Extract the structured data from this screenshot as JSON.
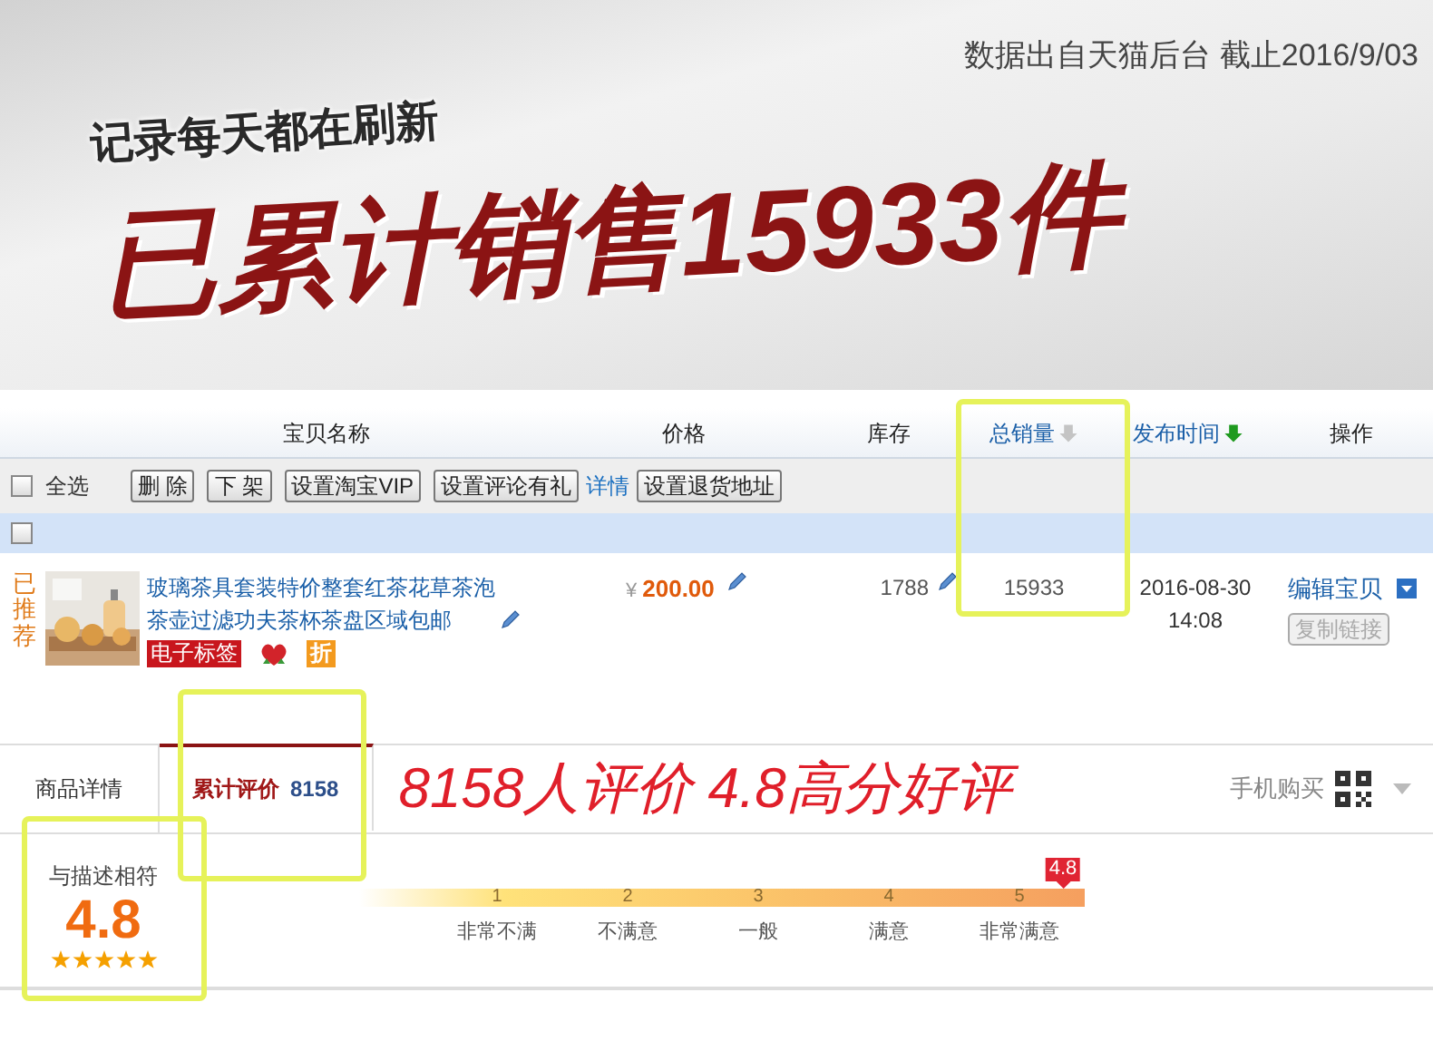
{
  "banner": {
    "source_note": "数据出自天猫后台 截止2016/9/03",
    "tagline": "记录每天都在刷新",
    "headline": "已累计销售15933件"
  },
  "table": {
    "columns": [
      {
        "label": "宝贝名称",
        "kind": "plain"
      },
      {
        "label": "价格",
        "kind": "plain"
      },
      {
        "label": "库存",
        "kind": "plain"
      },
      {
        "label": "总销量",
        "kind": "sortable",
        "active": false
      },
      {
        "label": "发布时间",
        "kind": "sortable",
        "active": true
      },
      {
        "label": "操作",
        "kind": "plain"
      }
    ],
    "select_all": {
      "label": "全选",
      "checked": false
    },
    "actions": [
      {
        "label": "删 除",
        "kind": "button"
      },
      {
        "label": "下 架",
        "kind": "button"
      },
      {
        "label": "设置淘宝VIP",
        "kind": "button"
      },
      {
        "label": "设置评论有礼",
        "kind": "button"
      },
      {
        "label": "详情",
        "kind": "link"
      },
      {
        "label": "设置退货地址",
        "kind": "button"
      }
    ],
    "group_row": {
      "checked": false
    },
    "product": {
      "recommend": "已推荐",
      "title": "玻璃茶具套装特价整套红茶花草茶泡茶壶过滤功夫茶杯茶盘区域包邮",
      "tag": "电子标签",
      "discount": "折",
      "price_symbol": "¥",
      "price": "200.00",
      "stock": "1788",
      "sales": "15933",
      "published_date": "2016-08-30",
      "published_time": "14:08",
      "edit": "编辑宝贝",
      "copy": "复制链接"
    }
  },
  "tabs": [
    {
      "label": "商品详情",
      "selected": false
    },
    {
      "label": "累计评价",
      "count": "8158",
      "selected": true
    }
  ],
  "promo": "8158人评价 4.8高分好评",
  "mobile_buy": "手机购买",
  "rating": {
    "label": "与描述相符",
    "score": "4.8",
    "stars": 5,
    "marker": "4.8",
    "level": 0.97,
    "scale": [
      {
        "value": "1",
        "label": "非常不满"
      },
      {
        "value": "2",
        "label": "不满意"
      },
      {
        "value": "3",
        "label": "一般"
      },
      {
        "value": "4",
        "label": "满意"
      },
      {
        "value": "5",
        "label": "非常满意"
      }
    ]
  }
}
